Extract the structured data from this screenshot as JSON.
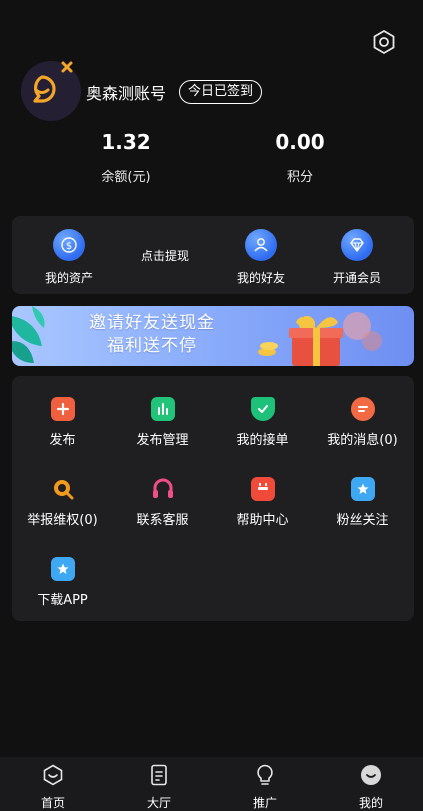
{
  "profile": {
    "username": "奥森测账号",
    "checkin_label": "今日已签到"
  },
  "stats": [
    {
      "value": "1.32",
      "label": "余额(元)"
    },
    {
      "value": "0.00",
      "label": "积分"
    }
  ],
  "quick_actions": [
    {
      "label": "我的资产",
      "icon": "dollar-coin-icon"
    },
    {
      "label": "点击提现",
      "icon": ""
    },
    {
      "label": "我的好友",
      "icon": "friends-icon"
    },
    {
      "label": "开通会员",
      "icon": "diamond-icon"
    }
  ],
  "banner": {
    "line1": "邀请好友送现金",
    "line2": "福利送不停"
  },
  "services": [
    {
      "label": "发布",
      "icon": "plus-icon",
      "color": "#f0603e"
    },
    {
      "label": "发布管理",
      "icon": "bar-chart-icon",
      "color": "#22c47a"
    },
    {
      "label": "我的接单",
      "icon": "shield-check-icon",
      "color": "#1ec17a"
    },
    {
      "label": "我的消息(0)",
      "icon": "message-icon",
      "color": "#f26a44"
    },
    {
      "label": "举报维权(0)",
      "icon": "search-report-icon",
      "color": "#f29a1d"
    },
    {
      "label": "联系客服",
      "icon": "headset-icon",
      "color": "#ef4f86"
    },
    {
      "label": "帮助中心",
      "icon": "help-box-icon",
      "color": "#ef4a3a"
    },
    {
      "label": "粉丝关注",
      "icon": "star-icon",
      "color": "#3fa8f2"
    },
    {
      "label": "下载APP",
      "icon": "star-download-icon",
      "color": "#3fa8f2"
    }
  ],
  "tabs": [
    {
      "label": "首页",
      "icon": "home-icon",
      "active": false
    },
    {
      "label": "大厅",
      "icon": "document-icon",
      "active": false
    },
    {
      "label": "推广",
      "icon": "bulb-icon",
      "active": false
    },
    {
      "label": "我的",
      "icon": "smile-icon",
      "active": true
    }
  ]
}
